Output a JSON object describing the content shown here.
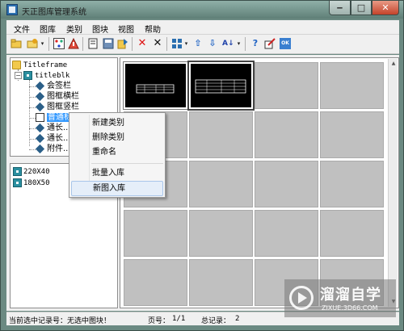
{
  "window": {
    "title": "天正图库管理系统",
    "min_glyph": "‒",
    "max_glyph": "□",
    "close_glyph": "✕"
  },
  "menu": [
    "文件",
    "图库",
    "类别",
    "图块",
    "视图",
    "帮助"
  ],
  "toolbar": {
    "icons": [
      "open-folder-icon",
      "open-library-icon",
      "category-dots-icon",
      "triangle-warning-icon",
      "book-icon",
      "save-disk-icon",
      "export-icon",
      "delete-red-icon",
      "delete-icon",
      "view-mode-icon",
      "move-up-icon",
      "move-down-icon",
      "sort-az-icon",
      "help-icon",
      "edit-icon",
      "ok-icon"
    ],
    "glyphs": {
      "delete_red": "✕",
      "delete": "✕",
      "up": "⇧",
      "down": "⇩",
      "sort": "A↓",
      "help": "?",
      "ok": "OK",
      "dropdown": "▾"
    }
  },
  "tree": {
    "root": "Titleframe",
    "blk": "titleblk",
    "items": [
      "会签栏",
      "图框横栏",
      "图框竖栏",
      "普通标题栏",
      "通长...",
      "通长...",
      "附件..."
    ],
    "expander": "−"
  },
  "size_list": [
    "220X40",
    "180X50"
  ],
  "context_menu": {
    "items": [
      "新建类别",
      "删除类别",
      "重命名",
      "批量入库",
      "新图入库"
    ],
    "hovered": "新图入库"
  },
  "scroll": {
    "up": "▲",
    "down": "▼"
  },
  "status": {
    "selection": "当前选中记录号：无选中图块！",
    "page_label": "页号：",
    "page_value": "1/1",
    "total_label": "总记录：",
    "total_value": "2"
  },
  "watermark": {
    "name": "溜溜自学",
    "url": "ZIXUE.3D66.COM"
  }
}
